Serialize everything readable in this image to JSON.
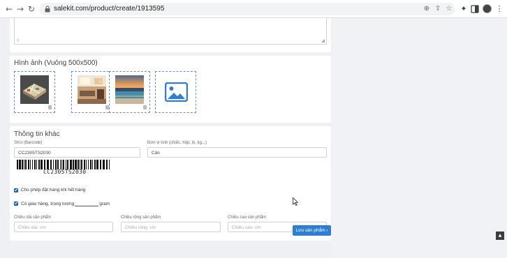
{
  "browser": {
    "url": "salekit.com/product/create/1913595",
    "icons": [
      "back-icon",
      "forward-icon",
      "reload-icon",
      "lock-icon",
      "zoom-icon",
      "share-icon",
      "star-icon",
      "extensions-icon",
      "sidebar-icon",
      "menu-icon"
    ]
  },
  "description": {
    "char_count": "0"
  },
  "images": {
    "title": "Hình ảnh (Vuông 500x500)",
    "items": [
      {
        "name": "floorplan-3d"
      },
      {
        "name": "living-room"
      },
      {
        "name": "rooftop-pool-sunset"
      },
      {
        "name": "add-image-placeholder"
      }
    ]
  },
  "other_info": {
    "title": "Thông tin khác",
    "sku_label": "SKU (Barcode)",
    "sku_value": "CC2305TS2030",
    "barcode_text": "CC2305TS2030",
    "unit_label": "Đơn vị tính (chiếc, hộp, lọ, kg...)",
    "unit_value": "Căn",
    "allow_order_label": "Cho phép đặt hàng khi hết hàng",
    "allow_order_checked": true,
    "shipping_label_prefix": "Có giao hàng, trọng lượng",
    "shipping_label_suffix": "gram",
    "shipping_checked": true,
    "length_label": "Chiều dài sản phẩm",
    "length_placeholder": "Chiều dài: cm",
    "width_label": "Chiều rộng sản phẩm",
    "width_placeholder": "Chiều rộng: cm",
    "height_label": "Chiều cao sản phẩm",
    "height_placeholder": "Chiều cao: cm"
  },
  "actions": {
    "save_label": "Lưu sản phẩm ›"
  },
  "colors": {
    "primary": "#2f7fd1",
    "checkbox": "#1565c0",
    "page_bg": "#eef0f3",
    "card_bg": "#ffffff"
  }
}
